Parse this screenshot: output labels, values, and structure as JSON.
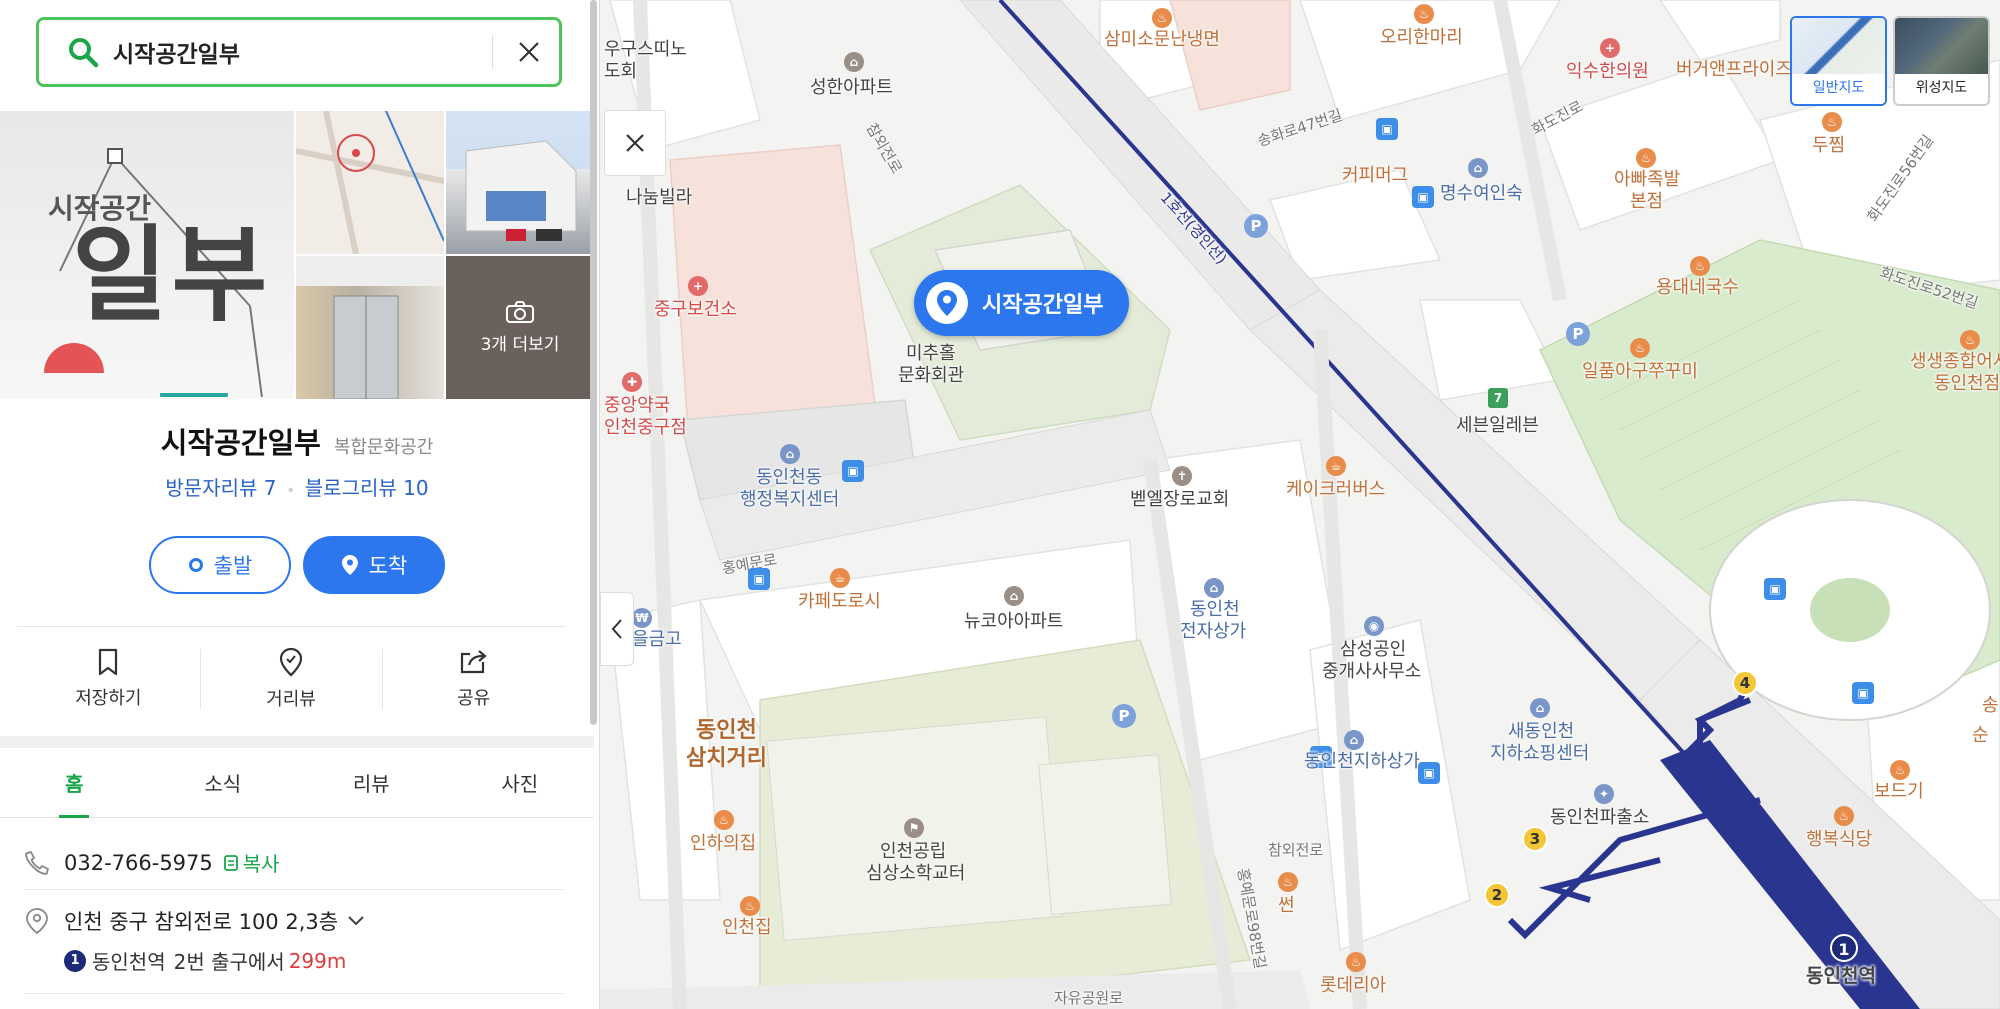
{
  "search": {
    "value": "시작공간일부",
    "clear_icon": "close-icon"
  },
  "photos": {
    "logo_line1": "시작공간",
    "logo_line2": "일부",
    "more_label": "3개 더보기"
  },
  "place": {
    "name": "시작공간일부",
    "category": "복합문화공간",
    "visitor_review": "방문자리뷰 7",
    "blog_review": "블로그리뷰 10"
  },
  "route": {
    "depart": "출발",
    "arrive": "도착"
  },
  "actions": {
    "save": "저장하기",
    "street_view": "거리뷰",
    "share": "공유"
  },
  "tabs": [
    "홈",
    "소식",
    "리뷰",
    "사진"
  ],
  "active_tab": "홈",
  "info": {
    "phone": "032-766-5975",
    "copy": "복사",
    "address": "인천 중구 참외전로 100 2,3층",
    "station_num": "1",
    "station_name": "동인천역",
    "exit": "2번 출구에서",
    "distance": "299m"
  },
  "map": {
    "selected_marker": "시작공간일부",
    "map_type": {
      "normal": "일반지도",
      "satellite": "위성지도",
      "active": "일반지도"
    },
    "rail_line": "1호선(경인선)",
    "labels": {
      "samisoman": "삼미소문난냉면",
      "ori": "오리한마리",
      "iksu": "익수한의원",
      "burger": "버거앤프라이즈",
      "dujim": "두찜",
      "uguseu1": "우구스띠노",
      "uguseu2": "도회",
      "seonghan": "성한아파트",
      "songhwa": "송화로47번길",
      "hwado": "화도진로",
      "coffee_mug": "커피머그",
      "myeongsu": "명수여인숙",
      "appa1": "아빠족발",
      "appa2": "본점",
      "hwado56": "화도진로56번길",
      "hwado52": "화도진로52번길",
      "nanum": "나눔빌라",
      "chamoe_st": "참외전로",
      "yongdae": "용대네국수",
      "junggu_health": "중구보건소",
      "michu1": "미추홀",
      "michu2": "문화회관",
      "ilpum": "일품아구쭈꾸미",
      "seven": "세븐일레븐",
      "saengsaeng1": "생생종합어시",
      "saengsaeng2": "동인천점",
      "jungang1": "중앙약국",
      "jungang2": "인천중구점",
      "dongin_office1": "동인천동",
      "dongin_office2": "행정복지센터",
      "bethel": "벧엘장로교회",
      "cake": "케이크러버스",
      "hongye": "홍예문로",
      "cafe_dorosi": "카페도로시",
      "newkorea": "뉴코아아파트",
      "dongin_elec1": "동인천",
      "dongin_elec2": "전자상가",
      "eulgeum": "을금고",
      "samsung1": "삼성공인",
      "samsung2": "중개사사무소",
      "samchi1": "동인천",
      "samchi2": "삼치거리",
      "saedong1": "새동인천",
      "saedong2": "지하쇼핑센터",
      "dongin_under": "동인천지하상가",
      "dongin_police": "동인천파출소",
      "boreugi": "보드기",
      "haengbok": "행복식당",
      "inha": "인하의집",
      "school1": "인천공립",
      "school2": "심상소학교터",
      "chamoe2": "참외전로",
      "sseon": "썬",
      "hongye98": "홍예문로98번길",
      "incheonjip": "인천집",
      "lotteria": "롯데리아",
      "jayu": "자유공원로",
      "station": "동인천역",
      "sun_partial": "순",
      "song_partial": "송"
    },
    "exits": [
      "4",
      "3",
      "2"
    ],
    "station_num": "1",
    "colors": {
      "accent": "#2c77ee",
      "green": "#19a549",
      "rail": "#1e2b78",
      "park": "#d8ebcc"
    }
  }
}
